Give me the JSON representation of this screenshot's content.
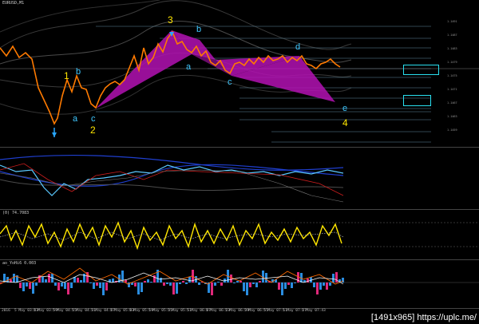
{
  "window": {
    "title": "EURUSD,M1"
  },
  "main": {
    "title": "EURUSD,M1",
    "wave_labels": {
      "w1": "1",
      "wb1": "b",
      "wa1": "a",
      "wc1": "c",
      "w2": "2",
      "w3": "3",
      "wb2": "b",
      "wa2": "a",
      "wc2": "c",
      "wd": "d",
      "we": "e",
      "w4": "4"
    }
  },
  "osc1": {
    "title": ""
  },
  "osc2": {
    "title": "(0) 74.7083"
  },
  "osc3": {
    "title": "ao_YoHi6 0.003"
  },
  "time_axis": {
    "ticks": [
      "2016",
      "5 May 03:43",
      "5 May 03:59",
      "5 May 04:15",
      "5 May 04:31",
      "5 May 04:47",
      "5 May 05:03",
      "5 May 05:19",
      "5 May 05:35",
      "5 May 05:51",
      "5 May 06:07",
      "5 May 06:23",
      "5 May 06:39",
      "5 May 06:55",
      "5 May 07:11",
      "5 May 07:27",
      "5 May 07:43"
    ]
  },
  "watermark": {
    "text": "[1491x965] https://uplc.me/"
  },
  "colors": {
    "harmonic": "#b312b3",
    "candle": "#ff7a00",
    "accent": "#29e0f0",
    "wave": "#ffe600"
  }
}
